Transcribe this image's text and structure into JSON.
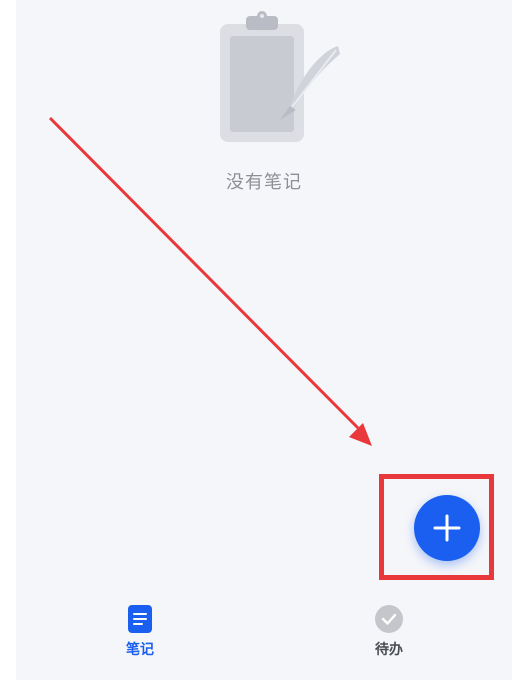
{
  "empty_state": {
    "icon": "clipboard-quill-icon",
    "message": "没有笔记"
  },
  "fab": {
    "icon": "plus-icon",
    "color": "#1a5ff0"
  },
  "bottom_nav": {
    "items": [
      {
        "label": "笔记",
        "icon": "notes-icon",
        "active": true
      },
      {
        "label": "待办",
        "icon": "todo-check-icon",
        "active": false
      }
    ],
    "active_color": "#1a5ff0",
    "inactive_color": "#4a4d54"
  },
  "annotation": {
    "arrow_color": "#e8383b",
    "box_color": "#e8383b"
  }
}
